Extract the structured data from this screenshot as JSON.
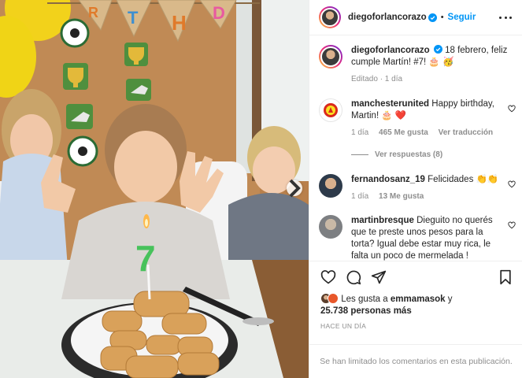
{
  "photo": {
    "banner_letters": [
      "R",
      "T",
      "H",
      "D"
    ],
    "candle_number": "7"
  },
  "post": {
    "author": "diegoforlancorazo",
    "follow_label": "Seguir",
    "separator": "•",
    "caption_text": "18 febrero, feliz cumple Martín! #7! 🎂 🥳",
    "caption_meta": "Editado · 1 día"
  },
  "comments": [
    {
      "user": "manchesterunited",
      "text": "Happy birthday, Martin! 🎂 ❤️",
      "time": "1 día",
      "likes": "465 Me gusta",
      "translate": "Ver traducción"
    },
    {
      "user": "fernandosanz_19",
      "text": "Felicidades 👏👏",
      "time": "1 día",
      "likes": "13 Me gusta"
    },
    {
      "user": "martinbresque",
      "text": "Dieguito no querés que te preste unos pesos para la torta? Igual debe estar muy rica, le falta un poco de mermelada !"
    }
  ],
  "replies_label": "Ver respuestas (8)",
  "likes": {
    "prefix": "Les gusta a",
    "user": "emmamasok",
    "joiner": "y",
    "count": "25.738 personas más"
  },
  "timestamp": "HACE UN DÍA",
  "comments_limited": "Se han limitado los comentarios en esta publicación.",
  "colors": {
    "accent": "#0095f6",
    "text": "#262626",
    "secondary": "#8e8e8e",
    "heart_red": "#ed4956"
  }
}
